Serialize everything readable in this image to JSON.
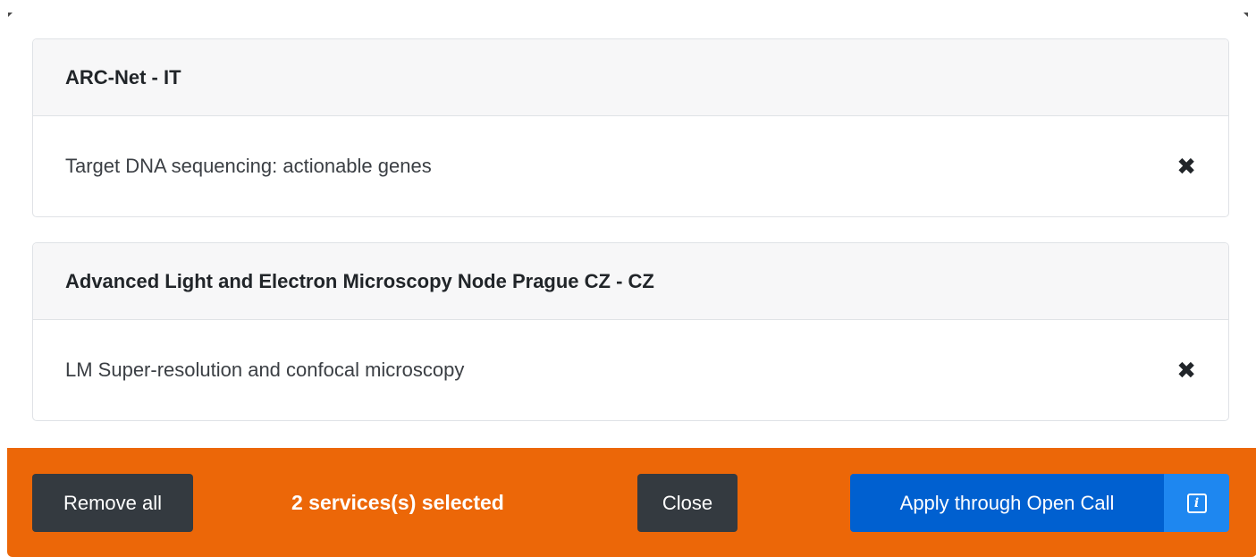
{
  "selected_services": [
    {
      "provider": "ARC-Net - IT",
      "service": "Target DNA sequencing: actionable genes",
      "remove_icon": "✖"
    },
    {
      "provider": "Advanced Light and Electron Microscopy Node Prague CZ - CZ",
      "service": "LM Super-resolution and confocal microscopy",
      "remove_icon": "✖"
    }
  ],
  "footer": {
    "remove_all_label": "Remove all",
    "selected_count_text": "2 services(s) selected",
    "close_label": "Close",
    "apply_label": "Apply through Open Call",
    "info_icon": "i"
  },
  "colors": {
    "footer_bg": "#ec6708",
    "dark_button": "#343a40",
    "apply_button": "#0060d0",
    "info_button": "#1e87f0"
  }
}
